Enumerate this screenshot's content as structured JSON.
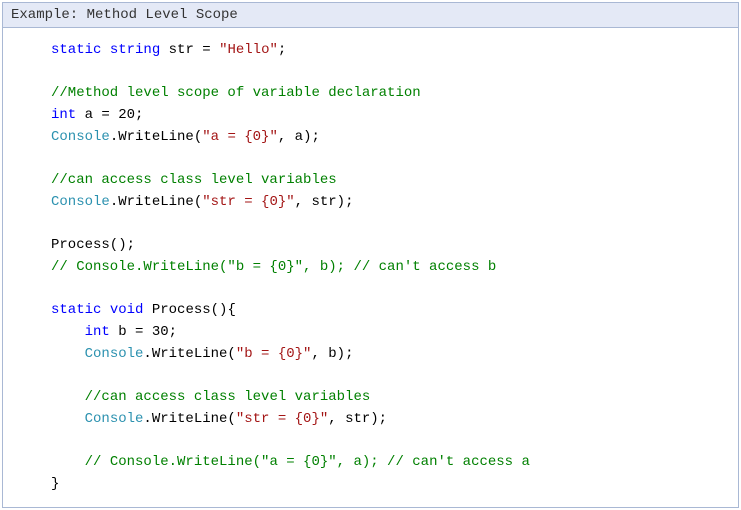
{
  "header": {
    "title": "Example: Method Level Scope"
  },
  "code": {
    "l1_kw1": "static",
    "l1_kw2": "string",
    "l1_name": " str = ",
    "l1_str": "\"Hello\"",
    "l1_end": ";",
    "blank": "",
    "l3_com": "//Method level scope of variable declaration",
    "l4_kw": "int",
    "l4_rest": " a = 20;",
    "l5_typ": "Console",
    "l5_mid": ".WriteLine(",
    "l5_str": "\"a = {0}\"",
    "l5_end": ", a);",
    "l7_com": "//can access class level variables",
    "l8_typ": "Console",
    "l8_mid": ".WriteLine(",
    "l8_str": "\"str = {0}\"",
    "l8_end": ", str);",
    "l10": "Process();",
    "l11_com": "// Console.WriteLine(\"b = {0}\", b); // can't access b",
    "l13_kw1": "static",
    "l13_kw2": "void",
    "l13_rest": " Process(){",
    "indent": "    ",
    "l14_kw": "int",
    "l14_rest": " b = 30;",
    "l15_typ": "Console",
    "l15_mid": ".WriteLine(",
    "l15_str": "\"b = {0}\"",
    "l15_end": ", b);",
    "l17_com": "//can access class level variables",
    "l18_typ": "Console",
    "l18_mid": ".WriteLine(",
    "l18_str": "\"str = {0}\"",
    "l18_end": ", str);",
    "l20_com": "// Console.WriteLine(\"a = {0}\", a); // can't access a",
    "l21": "}"
  }
}
